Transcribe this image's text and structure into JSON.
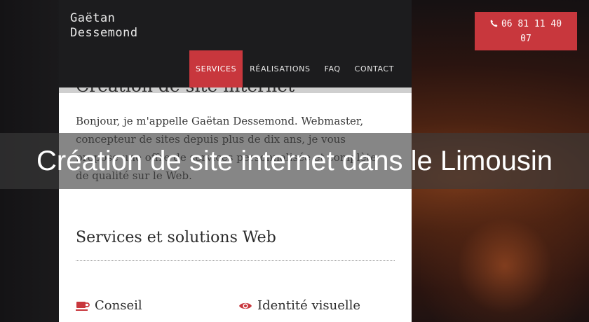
{
  "brand": {
    "line1": "Gaëtan",
    "line2": "Dessemond"
  },
  "nav": [
    {
      "label": "SERVICES",
      "active": true
    },
    {
      "label": "RÉALISATIONS",
      "active": false
    },
    {
      "label": "FAQ",
      "active": false
    },
    {
      "label": "CONTACT",
      "active": false
    }
  ],
  "phone": {
    "line1": "06 81 11 40",
    "line2": "07",
    "icon": "phone-icon"
  },
  "content": {
    "partial_heading": "Création de site internet",
    "intro": "Bonjour, je m'appelle Gaëtan Dessemond. Webmaster, concepteur de sites depuis plus de dix ans, je vous propose une offre de services personnalisée et complète de qualité sur le Web.",
    "section_title": "Services et solutions Web",
    "services": [
      {
        "icon": "coffee-cup-icon",
        "label": "Conseil"
      },
      {
        "icon": "eye-icon",
        "label": "Identité visuelle"
      }
    ]
  },
  "overlay_title": "Création de site internet dans le Limousin",
  "colors": {
    "accent": "#c8373d",
    "header": "#1c1c1e"
  }
}
